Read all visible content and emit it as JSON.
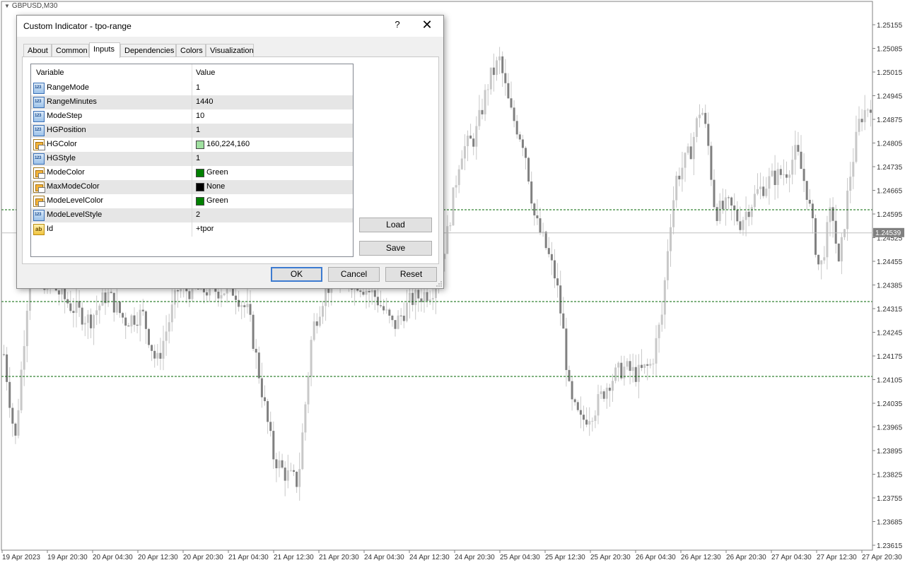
{
  "chart": {
    "symbol": "GBPUSD,M30",
    "price_labels": [
      "1.25155",
      "1.25085",
      "1.25015",
      "1.24945",
      "1.24875",
      "1.24805",
      "1.24735",
      "1.24665",
      "1.24595",
      "1.24525",
      "1.24455",
      "1.24385",
      "1.24315",
      "1.24245",
      "1.24175",
      "1.24105",
      "1.24035",
      "1.23965",
      "1.23895",
      "1.23825",
      "1.23755",
      "1.23685",
      "1.23615"
    ],
    "current_price": "1.24539",
    "time_labels": [
      "19 Apr 2023",
      "19 Apr 20:30",
      "20 Apr 04:30",
      "20 Apr 12:30",
      "20 Apr 20:30",
      "21 Apr 04:30",
      "21 Apr 12:30",
      "21 Apr 20:30",
      "24 Apr 04:30",
      "24 Apr 12:30",
      "24 Apr 20:30",
      "25 Apr 04:30",
      "25 Apr 12:30",
      "25 Apr 20:30",
      "26 Apr 04:30",
      "26 Apr 12:30",
      "26 Apr 20:30",
      "27 Apr 04:30",
      "27 Apr 12:30",
      "27 Apr 20:30"
    ],
    "level_color": "#006400",
    "candle_color": "#808080",
    "wick_color": "#c8c8c8"
  },
  "dialog": {
    "title": "Custom Indicator - tpo-range",
    "help_label": "?",
    "close_label": "✕",
    "tabs": [
      {
        "label": "About"
      },
      {
        "label": "Common"
      },
      {
        "label": "Inputs"
      },
      {
        "label": "Dependencies"
      },
      {
        "label": "Colors"
      },
      {
        "label": "Visualization"
      }
    ],
    "active_tab": "Inputs",
    "grid": {
      "col_variable": "Variable",
      "col_value": "Value",
      "rows": [
        {
          "icon": "number-icon",
          "variable": "RangeMode",
          "value": "1"
        },
        {
          "icon": "number-icon",
          "variable": "RangeMinutes",
          "value": "1440"
        },
        {
          "icon": "number-icon",
          "variable": "ModeStep",
          "value": "10"
        },
        {
          "icon": "number-icon",
          "variable": "HGPosition",
          "value": "1"
        },
        {
          "icon": "color-icon",
          "variable": "HGColor",
          "value": "160,224,160",
          "swatch": "#a0e0a0"
        },
        {
          "icon": "number-icon",
          "variable": "HGStyle",
          "value": "1"
        },
        {
          "icon": "color-icon",
          "variable": "ModeColor",
          "value": "Green",
          "swatch": "#008000"
        },
        {
          "icon": "color-icon",
          "variable": "MaxModeColor",
          "value": "None",
          "swatch": "#000000"
        },
        {
          "icon": "color-icon",
          "variable": "ModeLevelColor",
          "value": "Green",
          "swatch": "#008000"
        },
        {
          "icon": "number-icon",
          "variable": "ModeLevelStyle",
          "value": "2"
        },
        {
          "icon": "string-icon",
          "variable": "Id",
          "value": "+tpor"
        }
      ]
    },
    "buttons": {
      "load": "Load",
      "save": "Save",
      "ok": "OK",
      "cancel": "Cancel",
      "reset": "Reset"
    }
  }
}
